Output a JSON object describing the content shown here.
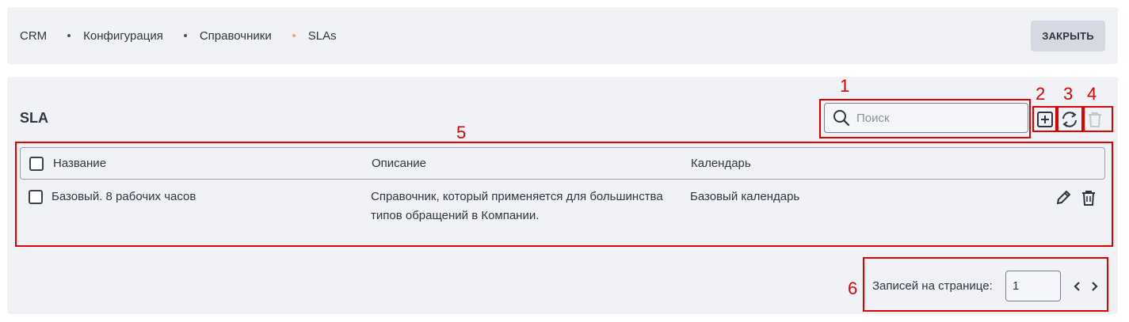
{
  "breadcrumb": {
    "items": [
      "CRM",
      "Конфигурация",
      "Справочники",
      "SLAs"
    ]
  },
  "header": {
    "close_label": "ЗАКРЫТЬ"
  },
  "section": {
    "title": "SLA"
  },
  "search": {
    "placeholder": "Поиск",
    "value": ""
  },
  "annotations": [
    "1",
    "2",
    "3",
    "4",
    "5",
    "6"
  ],
  "table": {
    "columns": [
      "Название",
      "Описание",
      "Календарь"
    ],
    "rows": [
      {
        "name": "Базовый. 8 рабочих часов",
        "description_line1": "Справочник, который применяется для большинства",
        "description_line2": "типов обращений в Компании.",
        "calendar": "Базовый календарь"
      }
    ]
  },
  "pagination": {
    "label": "Записей на странице:",
    "per_page": "1"
  },
  "colors": {
    "accent_dot": "#f2a55a",
    "annotation": "#e00000",
    "panel_bg": "#f0f2f6"
  }
}
